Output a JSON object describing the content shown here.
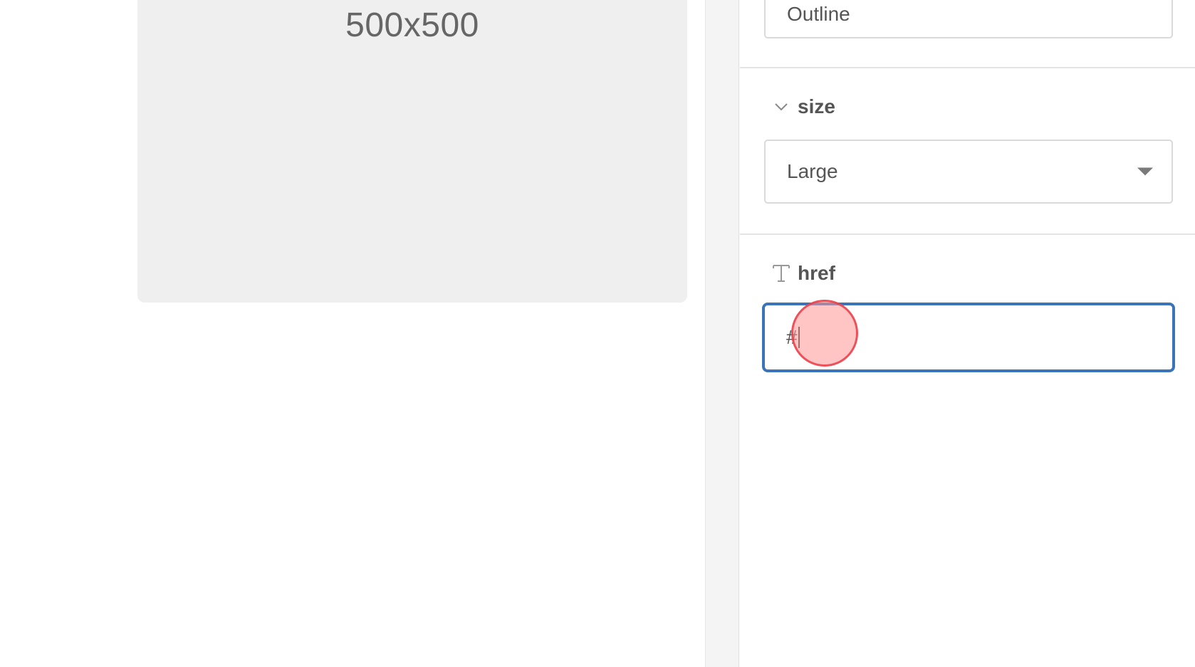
{
  "canvas": {
    "placeholder_label": "500x500"
  },
  "properties": {
    "variant": {
      "selected": "Outline",
      "icon": "caret-down-icon"
    },
    "size": {
      "label": "size",
      "icon": "chevron-down-icon",
      "selected": "Large"
    },
    "href": {
      "label": "href",
      "icon": "text-type-icon",
      "value": "#"
    }
  },
  "colors": {
    "focus_border": "#3b74b8",
    "click_indicator": "#ff9696"
  }
}
